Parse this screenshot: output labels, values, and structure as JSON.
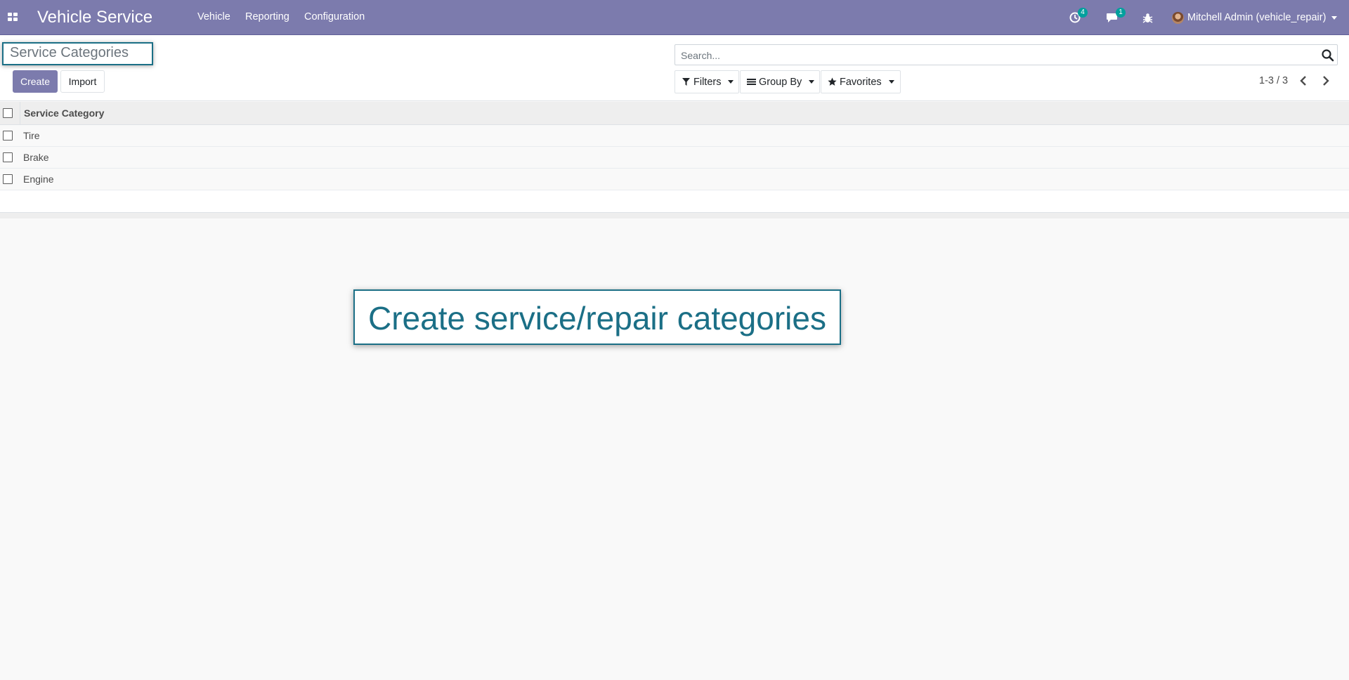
{
  "navbar": {
    "app_title": "Vehicle Service",
    "menu": [
      "Vehicle",
      "Reporting",
      "Configuration"
    ],
    "activity_count": "4",
    "message_count": "1",
    "user_name": "Mitchell Admin (vehicle_repair)",
    "background_color": "#7c7bad"
  },
  "control_panel": {
    "page_title": "Service Categories",
    "create_label": "Create",
    "import_label": "Import",
    "search_placeholder": "Search...",
    "filters_label": "Filters",
    "group_by_label": "Group By",
    "favorites_label": "Favorites",
    "pager_value": "1-3 / 3"
  },
  "list": {
    "column_header": "Service Category",
    "rows": [
      "Tire",
      "Brake",
      "Engine"
    ]
  },
  "callout": {
    "text": "Create service/repair categories",
    "color": "#1b6f86"
  },
  "icons": {
    "apps": "grid-icon",
    "activity": "clock-icon",
    "messages": "chat-icon",
    "debug": "bug-icon",
    "search": "search-icon",
    "filter": "funnel-icon",
    "group_by": "bars-icon",
    "favorites": "star-icon",
    "pager_prev": "chevron-left-icon",
    "pager_next": "chevron-right-icon"
  }
}
